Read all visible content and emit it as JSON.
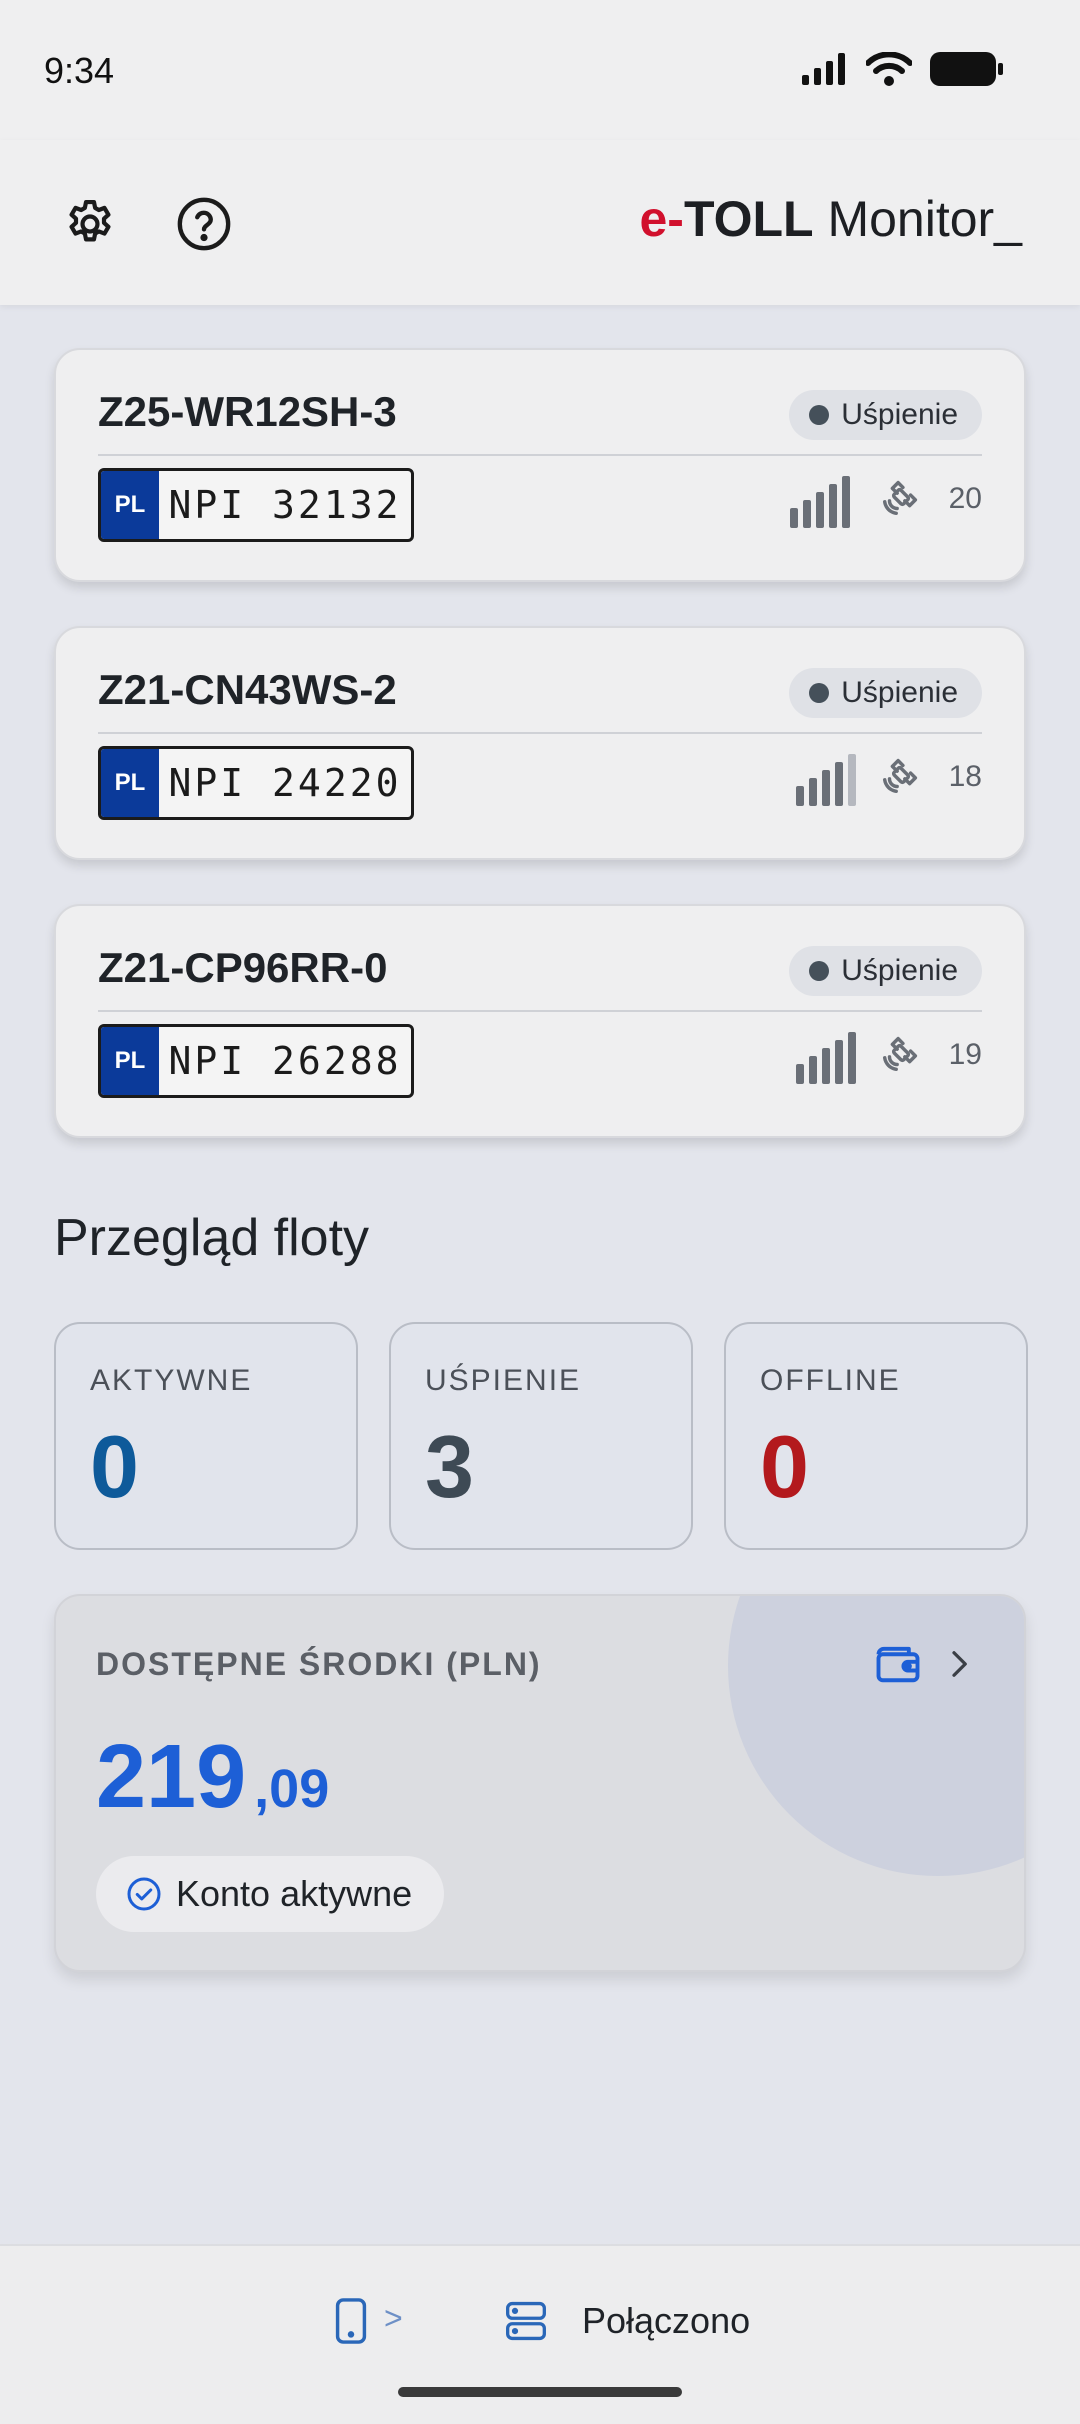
{
  "status_bar": {
    "time": "9:34"
  },
  "header": {
    "brand_e": "e-",
    "brand_toll": "TOLL",
    "brand_monitor": " Monitor_",
    "icons": [
      "gear-icon",
      "help-icon"
    ]
  },
  "devices": [
    {
      "id": "Z25-WR12SH-3",
      "status": "Uśpienie",
      "plate_country": "PL",
      "plate": "NPI 32132",
      "satellites": "20",
      "signal_bars": 5
    },
    {
      "id": "Z21-CN43WS-2",
      "status": "Uśpienie",
      "plate_country": "PL",
      "plate": "NPI 24220",
      "satellites": "18",
      "signal_bars": 4
    },
    {
      "id": "Z21-CP96RR-0",
      "status": "Uśpienie",
      "plate_country": "PL",
      "plate": "NPI 26288",
      "satellites": "19",
      "signal_bars": 5
    }
  ],
  "fleet": {
    "title": "Przegląd floty",
    "stats": [
      {
        "label": "AKTYWNE",
        "value": "0",
        "color": "#0e5a9a"
      },
      {
        "label": "UŚPIENIE",
        "value": "3",
        "color": "#3e4a55"
      },
      {
        "label": "OFFLINE",
        "value": "0",
        "color": "#b3191d"
      }
    ]
  },
  "funds": {
    "label": "DOSTĘPNE ŚRODKI (PLN)",
    "amount_int": "219",
    "amount_dec": ",09",
    "account_status": "Konto aktywne",
    "accent": "#1d5fd6"
  },
  "bottom_bar": {
    "arrow": ">",
    "connection": "Połączono"
  }
}
